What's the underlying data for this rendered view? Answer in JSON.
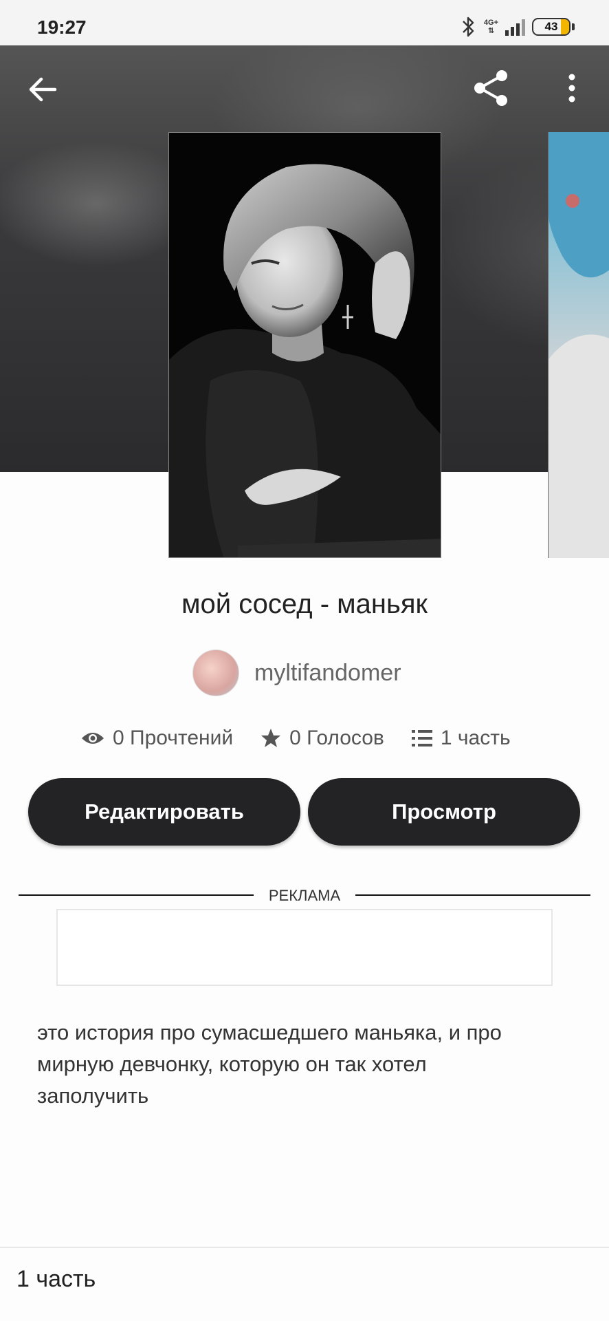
{
  "status_bar": {
    "time": "19:27",
    "network": "4G+",
    "battery": "43",
    "icons": [
      "bluetooth-icon",
      "signal-icon",
      "battery-icon"
    ]
  },
  "top_bar": {
    "back_icon": "arrow-left-icon",
    "share_icon": "share-icon",
    "more_icon": "more-vertical-icon"
  },
  "story": {
    "title": "мой сосед - маньяк",
    "author": "myltifandomer",
    "stats": {
      "reads": "0 Прочтений",
      "votes": "0 Голосов",
      "parts": "1 часть"
    },
    "description": "это история про сумасшедшего маньяка, и про мирную девчонку, которую он так хотел заполучить"
  },
  "actions": {
    "edit_label": "Редактировать",
    "view_label": "Просмотр"
  },
  "ad": {
    "label": "РЕКЛАМА"
  },
  "bottom": {
    "parts_label": "1 часть"
  },
  "colors": {
    "button_bg": "#232326",
    "battery_fill": "#f2b600",
    "hero_bg": "#3a3a3c"
  }
}
